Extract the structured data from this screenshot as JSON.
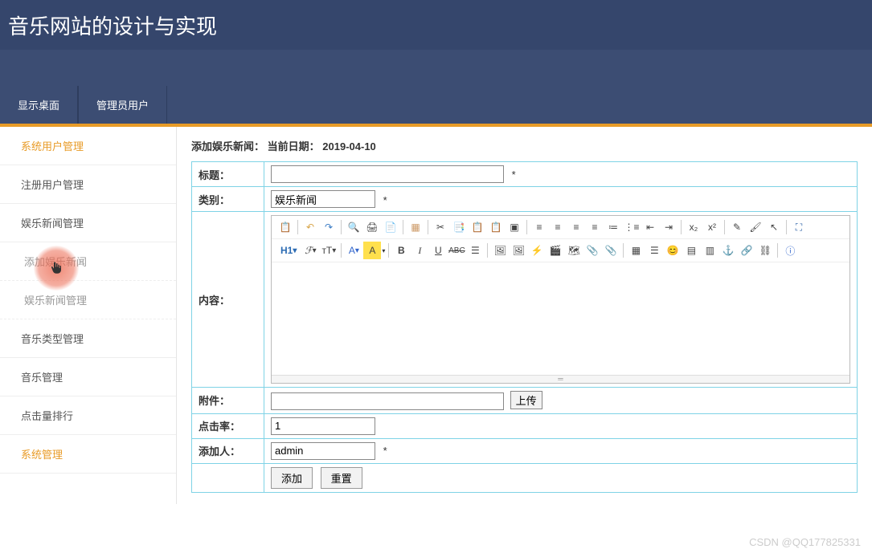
{
  "header": {
    "title": "音乐网站的设计与实现"
  },
  "tabs": {
    "desktop": "显示桌面",
    "admin_user": "管理员用户"
  },
  "sidebar": {
    "items": [
      {
        "label": "系统用户管理",
        "active": true
      },
      {
        "label": "注册用户管理"
      },
      {
        "label": "娱乐新闻管理",
        "sub": [
          {
            "label": "添加娱乐新闻"
          },
          {
            "label": "娱乐新闻管理"
          }
        ]
      },
      {
        "label": "音乐类型管理"
      },
      {
        "label": "音乐管理"
      },
      {
        "label": "点击量排行"
      },
      {
        "label": "系统管理",
        "active": true
      }
    ]
  },
  "breadcrumb": {
    "prefix": "添加娱乐新闻：",
    "date_label": "当前日期：",
    "date_value": "2019-04-10"
  },
  "form": {
    "title_label": "标题：",
    "title_value": "",
    "category_label": "类别：",
    "category_value": "娱乐新闻",
    "content_label": "内容：",
    "attachment_label": "附件：",
    "attachment_value": "",
    "upload_label": "上传",
    "clicks_label": "点击率：",
    "clicks_value": "1",
    "adder_label": "添加人：",
    "adder_value": "admin",
    "required_mark": "*",
    "submit_label": "添加",
    "reset_label": "重置"
  },
  "editor": {
    "h1": "H1",
    "font_family_glyph": "ℱ",
    "font_size_glyph": "тT",
    "font_color_glyph": "A",
    "highlight_glyph": "A",
    "bold": "B",
    "italic": "I",
    "underline": "U",
    "strike": "ABC"
  },
  "watermark": "CSDN @QQ177825331"
}
